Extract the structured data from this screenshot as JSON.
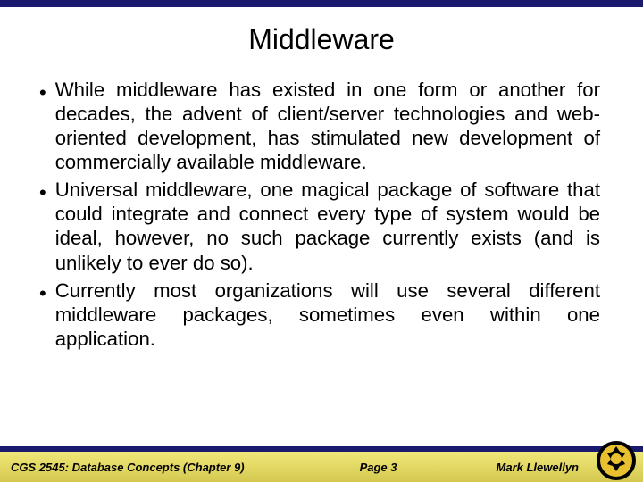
{
  "title": "Middleware",
  "bullets": [
    "While middleware has existed in one form or another for decades, the advent of client/server technologies and web-oriented development, has stimulated new development of commercially available middleware.",
    "Universal middleware, one magical package of software that could integrate and connect every type of system would be ideal, however, no such package currently exists (and is unlikely to ever do so).",
    "Currently most organizations will use several different middleware packages, sometimes even within one application."
  ],
  "footer": {
    "left": "CGS 2545: Database Concepts  (Chapter 9)",
    "center": "Page 3",
    "right": "Mark Llewellyn"
  }
}
